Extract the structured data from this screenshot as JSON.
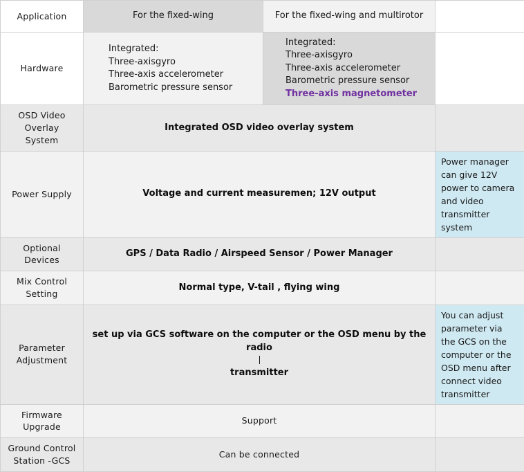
{
  "table": {
    "columns": [
      "Application",
      "For the fixed-wing",
      "For the fixed-wing and multirotor",
      ""
    ],
    "header": {
      "col1_label": "Application",
      "col2_label": "For the fixed-wing",
      "col3_label": "For the fixed-wing and multirotor",
      "col4_label": ""
    },
    "rows": {
      "hardware": {
        "label": "Hardware",
        "fixed_wing": {
          "line1": "Integrated:",
          "line2": "Three-axisgyro",
          "line3": "Three-axis accelerometer",
          "line4": "Barometric pressure sensor"
        },
        "multirotor": {
          "line1": "Integrated:",
          "line2": "Three-axisgyro",
          "line3": "Three-axis accelerometer",
          "line4": "Barometric pressure sensor",
          "line5": "Three-axis magnetometer"
        },
        "note": ""
      },
      "osd": {
        "label_line1": "OSD Video",
        "label_line2": "Overlay System",
        "value": "Integrated OSD video overlay system",
        "note": ""
      },
      "power_supply": {
        "label": "Power Supply",
        "value": "Voltage and current measuremen; 12V output",
        "note": "Power manager can give 12V power to camera and video transmitter system"
      },
      "optional_devices": {
        "label_line1": "Optional",
        "label_line2": "Devices",
        "value": "GPS / Data Radio / Airspeed Sensor / Power Manager",
        "note": ""
      },
      "mix_control": {
        "label_line1": "Mix Control",
        "label_line2": "Setting",
        "value": "Normal type, V-tail , flying wing",
        "note": ""
      },
      "parameter_adjustment": {
        "label_line1": "Parameter",
        "label_line2": "Adjustment",
        "value_line1": "set up via GCS software on the computer or the OSD menu by the radio",
        "value_line2": "transmitter",
        "note": "You can adjust parameter via the GCS on the computer or the OSD menu after connect video transmitter"
      },
      "firmware_upgrade": {
        "label_line1": "Firmware",
        "label_line2": "Upgrade",
        "value": "Support",
        "note": ""
      },
      "ground_control": {
        "label_line1": "Ground Control",
        "label_line2": "Station -GCS",
        "value": "Can be connected",
        "note": ""
      }
    }
  },
  "colors": {
    "highlight_purple": "#7030a0",
    "note_blue": "#cfe9f2",
    "shade_dark": "#d9d9d9",
    "shade_light": "#f2f2f2",
    "shade_mid": "#e8e8e8",
    "border": "#d0d0d0"
  }
}
